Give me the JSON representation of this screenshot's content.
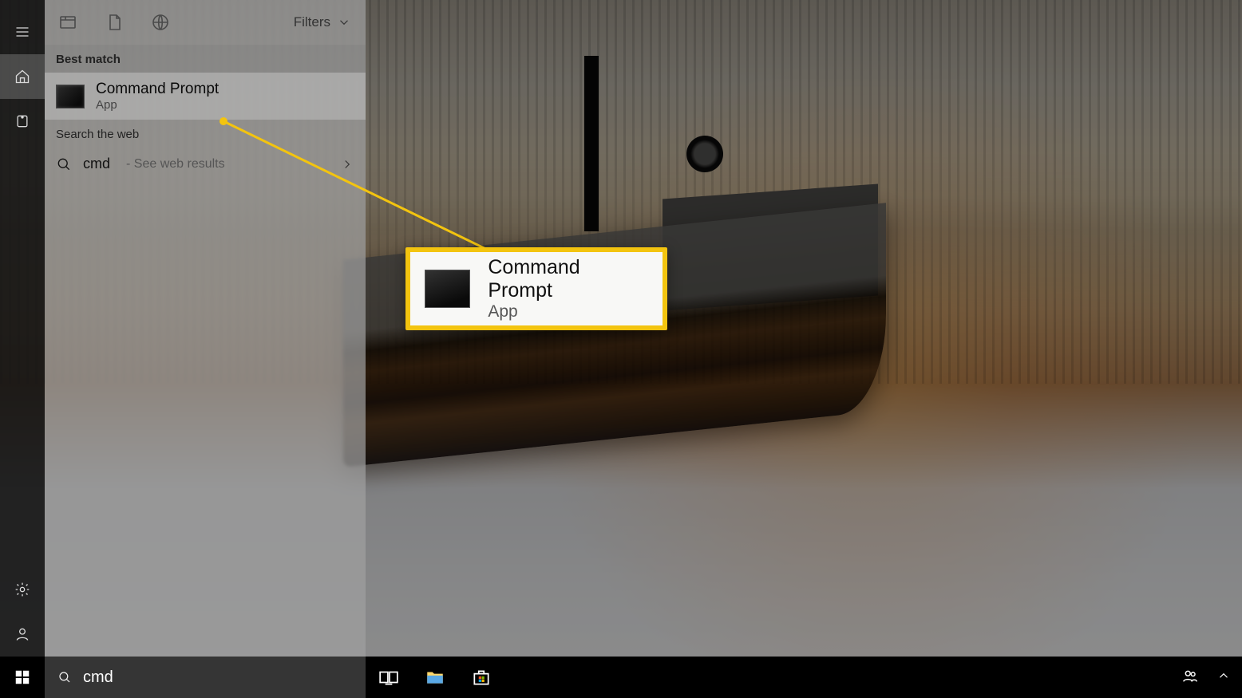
{
  "colors": {
    "accent": "#f3c40f"
  },
  "search": {
    "value": "cmd"
  },
  "results_panel": {
    "filters_label": "Filters",
    "section_best_match": "Best match",
    "section_web": "Search the web",
    "best_match": {
      "title": "Command Prompt",
      "subtitle": "App"
    },
    "web": {
      "query": "cmd",
      "hint": "- See web results"
    }
  },
  "callout": {
    "title": "Command Prompt",
    "subtitle": "App"
  },
  "rail_icons": {
    "menu": "hamburger-icon",
    "home": "home-icon",
    "timeline": "timeline-icon",
    "settings": "gear-icon",
    "user": "user-icon"
  },
  "header_icons": {
    "apps": "apps-icon",
    "docs": "document-icon",
    "web": "globe-icon"
  },
  "taskbar": {
    "icons": {
      "start": "windows-icon",
      "taskview": "taskview-icon",
      "explorer": "file-explorer-icon",
      "store": "store-icon",
      "people": "people-icon",
      "chevron": "chevron-up-icon"
    }
  }
}
